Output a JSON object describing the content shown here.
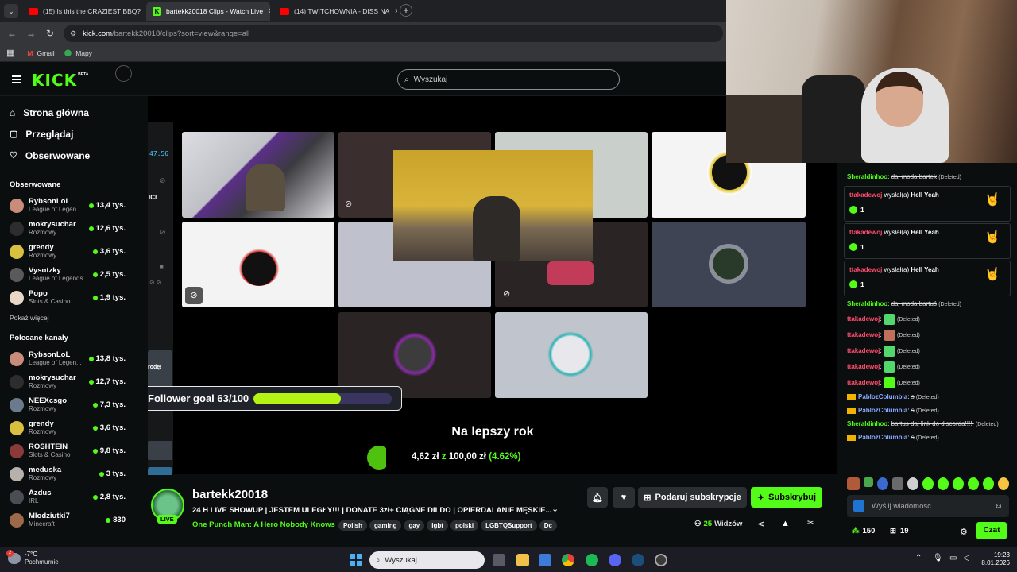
{
  "browser": {
    "tabs": [
      {
        "title": "(15) Is this the CRAZIEST BBQ?",
        "icon": "youtube-icon"
      },
      {
        "title": "bartekk20018 Clips - Watch Live",
        "icon": "kick-icon"
      },
      {
        "title": "(14) TWITCHOWNIA - DISS NA",
        "icon": "youtube-icon"
      }
    ],
    "url_host": "kick.com",
    "url_path": "/bartekk20018/clips?sort=view&range=all",
    "bookmarks": [
      "Gmail",
      "Mapy"
    ]
  },
  "header": {
    "logo": "KICK",
    "logo_badge": "BETA",
    "search_placeholder": "Wyszukaj"
  },
  "sidebar": {
    "nav": [
      {
        "label": "Strona główna",
        "icon": "home-icon"
      },
      {
        "label": "Przeglądaj",
        "icon": "browse-icon"
      },
      {
        "label": "Obserwowane",
        "icon": "heart-icon"
      }
    ],
    "following_title": "Obserwowane",
    "following": [
      {
        "name": "RybsonLoL",
        "category": "League of Legen...",
        "viewers": "13,4 tys.",
        "color": "#c98c7a"
      },
      {
        "name": "mokrysuchar",
        "category": "Rozmowy",
        "viewers": "12,6 tys.",
        "color": "#2d2d2d"
      },
      {
        "name": "grendy",
        "category": "Rozmowy",
        "viewers": "3,6 tys.",
        "color": "#d9c13f"
      },
      {
        "name": "Vysotzky",
        "category": "League of Legends",
        "viewers": "2,5 tys.",
        "color": "#5a5a5a"
      },
      {
        "name": "Popo",
        "category": "Slots & Casino",
        "viewers": "1,9 tys.",
        "color": "#e8d6c6"
      }
    ],
    "show_more": "Pokaż więcej",
    "recommended_title": "Polecane kanały",
    "recommended": [
      {
        "name": "RybsonLoL",
        "category": "League of Legen...",
        "viewers": "13,8 tys.",
        "color": "#c98c7a"
      },
      {
        "name": "mokrysuchar",
        "category": "Rozmowy",
        "viewers": "12,7 tys.",
        "color": "#2d2d2d"
      },
      {
        "name": "NEEXcsgo",
        "category": "Rozmowy",
        "viewers": "7,3 tys.",
        "color": "#6b7a8c"
      },
      {
        "name": "grendy",
        "category": "Rozmowy",
        "viewers": "3,6 tys.",
        "color": "#d9c13f"
      },
      {
        "name": "ROSHTEIN",
        "category": "Slots & Casino",
        "viewers": "9,8 tys.",
        "color": "#8a3a3a"
      },
      {
        "name": "meduska",
        "category": "Rozmowy",
        "viewers": "3 tys.",
        "color": "#b7b1ad"
      },
      {
        "name": "Azdus",
        "category": "IRL",
        "viewers": "2,8 tys.",
        "color": "#4a4d52"
      },
      {
        "name": "Mlodziutki7",
        "category": "Minecraft",
        "viewers": "830",
        "color": "#9c6a4a"
      }
    ]
  },
  "video": {
    "timer": "47:56",
    "side_label": "ICI",
    "side_label2": "rodę!",
    "goal_label": "Follower goal 63/100",
    "goal_fraction": 0.63,
    "donation_title": "Na lepszy rok",
    "donation_current": "4,62 zł",
    "donation_sep": "z",
    "donation_target": "100,00 zł",
    "donation_percent": "(4.62%)",
    "donation_fraction": 0.0462
  },
  "stream": {
    "channel": "bartekk20018",
    "live_badge": "LIVE",
    "title": "24 H LIVE SHOWUP | JESTEM ULEGŁY!!! | DONATE 3zł+ CIĄGNE DILDO | OPIERDALANIE MĘSKIE...",
    "category": "One Punch Man: A Hero Nobody Knows",
    "tags": [
      "Polish",
      "gaming",
      "gay",
      "lgbt",
      "polski",
      "LGBTQSupport",
      "Dc"
    ],
    "gift_button": "Podaruj subskrypcje",
    "subscribe_button": "Subskrybuj",
    "viewers": "25",
    "viewers_label": "Widzów",
    "accent": "#53fc18"
  },
  "chat": {
    "messages": [
      {
        "type": "text",
        "user": "Sheraldinhoo",
        "user_color": "#53fc18",
        "text": "daj moda bartek",
        "deleted": "(Deleted)"
      },
      {
        "type": "gift",
        "user": "ttakadewoj",
        "action": "wysłał(a)",
        "item": "Hell Yeah",
        "count": "1"
      },
      {
        "type": "gift",
        "user": "ttakadewoj",
        "action": "wysłał(a)",
        "item": "Hell Yeah",
        "count": "1"
      },
      {
        "type": "gift",
        "user": "ttakadewoj",
        "action": "wysłał(a)",
        "item": "Hell Yeah",
        "count": "1"
      },
      {
        "type": "text",
        "user": "Sheraldinhoo",
        "user_color": "#53fc18",
        "text": "daj moda bartuś",
        "deleted": "(Deleted)"
      },
      {
        "type": "emote",
        "user": "ttakadewoj",
        "user_color": "#ff4d6d",
        "emote_color": "#53d66b",
        "deleted": "(Deleted)"
      },
      {
        "type": "emote",
        "user": "ttakadewoj",
        "user_color": "#ff4d6d",
        "emote_color": "#c0705a",
        "deleted": "(Deleted)"
      },
      {
        "type": "emote",
        "user": "ttakadewoj",
        "user_color": "#ff4d6d",
        "emote_color": "#53d66b",
        "deleted": "(Deleted)"
      },
      {
        "type": "emote",
        "user": "ttakadewoj",
        "user_color": "#ff4d6d",
        "emote_color": "#53d66b",
        "deleted": "(Deleted)"
      },
      {
        "type": "emote",
        "user": "ttakadewoj",
        "user_color": "#ff4d6d",
        "emote_color": "#53fc18",
        "deleted": "(Deleted)"
      },
      {
        "type": "text",
        "user": "PablozColumbia",
        "user_color": "#8aa9ff",
        "text": "s",
        "deleted": "(Deleted)",
        "crown": true
      },
      {
        "type": "text",
        "user": "PablozColumbia",
        "user_color": "#8aa9ff",
        "text": "s",
        "deleted": "(Deleted)",
        "crown": true
      },
      {
        "type": "text",
        "user": "Sheraldinhoo",
        "user_color": "#53fc18",
        "text": "bartus daj link do discorda!!!!!",
        "deleted": "(Deleted)"
      },
      {
        "type": "text",
        "user": "PablozColumbia",
        "user_color": "#8aa9ff",
        "text": "s",
        "deleted": "(Deleted)",
        "crown": true
      }
    ],
    "input_placeholder": "Wyślij wiadomość",
    "points": "150",
    "gifts": "19",
    "send_button": "Czat"
  },
  "taskbar": {
    "weather_temp": "-7°C",
    "weather_text": "Pochmurnie",
    "search_placeholder": "Wyszukaj",
    "time": "19:23",
    "date": "8.01.2026"
  }
}
